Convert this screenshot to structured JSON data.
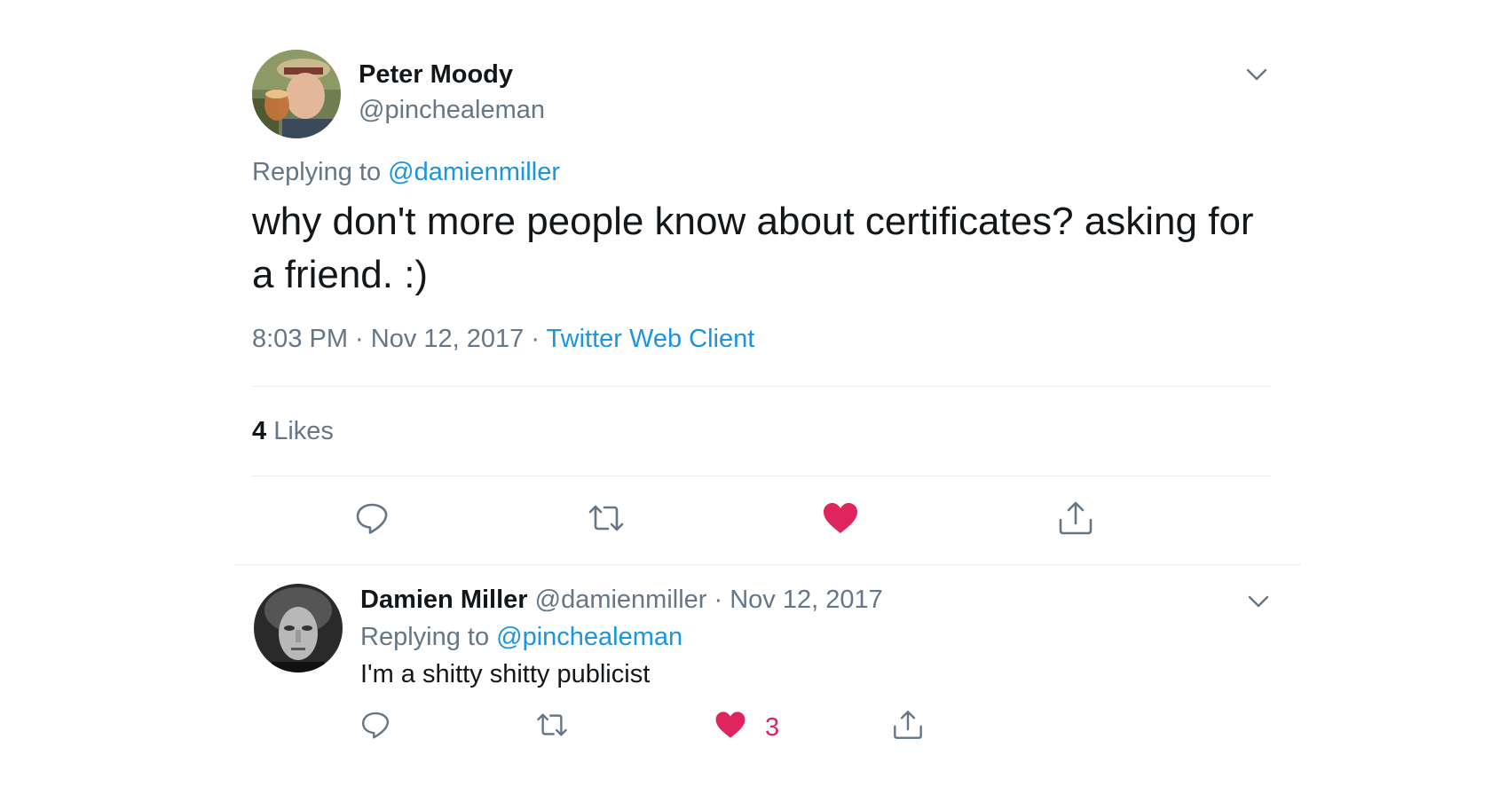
{
  "main_tweet": {
    "author_name": "Peter Moody",
    "author_handle": "@pinchealeman",
    "replying_prefix": "Replying to ",
    "replying_to": "@damienmiller",
    "text": "why don't more people know about certificates? asking for a friend. :)",
    "time": "8:03 PM",
    "date_separator": " · ",
    "date": "Nov 12, 2017",
    "source_separator": " · ",
    "source": "Twitter Web Client",
    "likes_count": "4",
    "likes_label": " Likes"
  },
  "reply_tweet": {
    "author_name": "Damien Miller",
    "author_handle": "@damienmiller",
    "separator": " · ",
    "date": "Nov 12, 2017",
    "replying_prefix": "Replying to ",
    "replying_to": "@pinchealeman",
    "text": "I'm a shitty shitty publicist",
    "like_count": "3"
  },
  "icons": {
    "reply": "reply-icon",
    "retweet": "retweet-icon",
    "like": "heart-icon",
    "share": "share-icon",
    "caret": "chevron-down-icon"
  },
  "colors": {
    "text_primary": "#14171a",
    "text_secondary": "#657786",
    "link": "#1b95e0",
    "like": "#e0245e",
    "divider": "#e6ecf0"
  }
}
